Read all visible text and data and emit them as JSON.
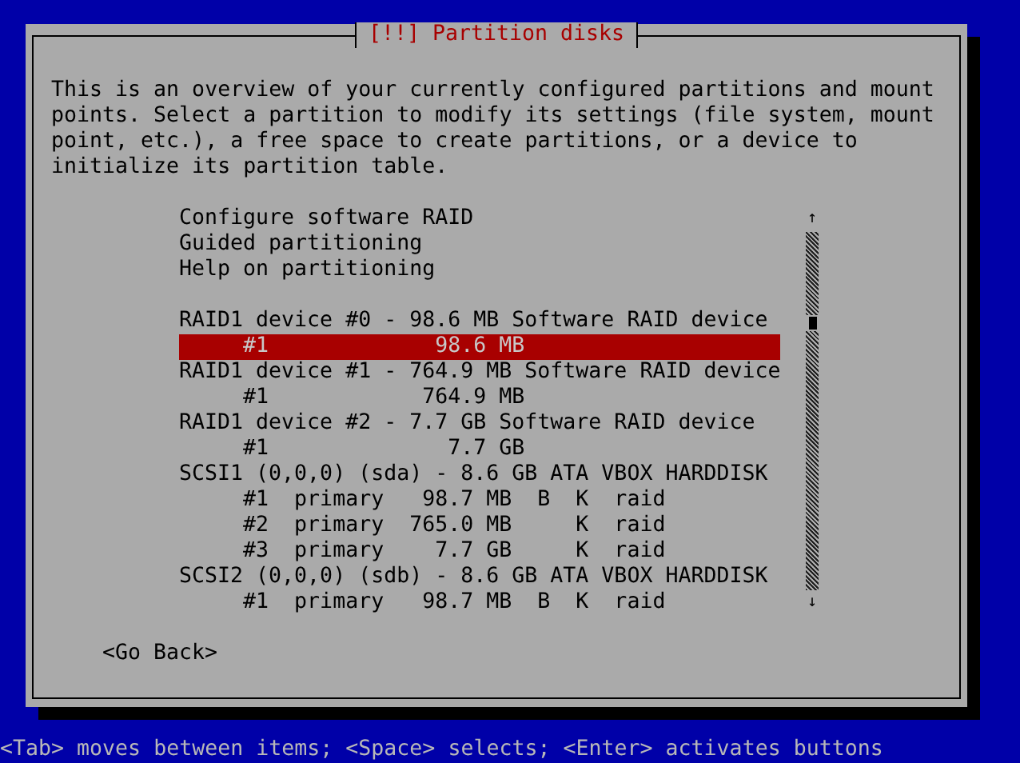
{
  "dialog": {
    "title": "[!!] Partition disks",
    "description": "This is an overview of your currently configured partitions and mount points. Select a partition to modify its settings (file system, mount point, etc.), a free space to create partitions, or a device to initialize its partition table.",
    "list": [
      {
        "kind": "action",
        "text": "Configure software RAID",
        "selected": false
      },
      {
        "kind": "action",
        "text": "Guided partitioning",
        "selected": false
      },
      {
        "kind": "action",
        "text": "Help on partitioning",
        "selected": false
      },
      {
        "kind": "blank"
      },
      {
        "kind": "device",
        "text": "RAID1 device #0 - 98.6 MB Software RAID device",
        "selected": false
      },
      {
        "kind": "partition",
        "text": "     #1             98.6 MB",
        "selected": true
      },
      {
        "kind": "device",
        "text": "RAID1 device #1 - 764.9 MB Software RAID device",
        "selected": false
      },
      {
        "kind": "partition",
        "text": "     #1            764.9 MB",
        "selected": false
      },
      {
        "kind": "device",
        "text": "RAID1 device #2 - 7.7 GB Software RAID device",
        "selected": false
      },
      {
        "kind": "partition",
        "text": "     #1              7.7 GB",
        "selected": false
      },
      {
        "kind": "device",
        "text": "SCSI1 (0,0,0) (sda) - 8.6 GB ATA VBOX HARDDISK",
        "selected": false
      },
      {
        "kind": "partition",
        "text": "     #1  primary   98.7 MB  B  K  raid",
        "selected": false
      },
      {
        "kind": "partition",
        "text": "     #2  primary  765.0 MB     K  raid",
        "selected": false
      },
      {
        "kind": "partition",
        "text": "     #3  primary    7.7 GB     K  raid",
        "selected": false
      },
      {
        "kind": "device",
        "text": "SCSI2 (0,0,0) (sdb) - 8.6 GB ATA VBOX HARDDISK",
        "selected": false
      },
      {
        "kind": "partition",
        "text": "     #1  primary   98.7 MB  B  K  raid",
        "selected": false
      }
    ],
    "scroll_up": "↑",
    "scroll_down": "↓",
    "button": "<Go Back>"
  },
  "status_bar": "<Tab> moves between items; <Space> selects; <Enter> activates buttons"
}
